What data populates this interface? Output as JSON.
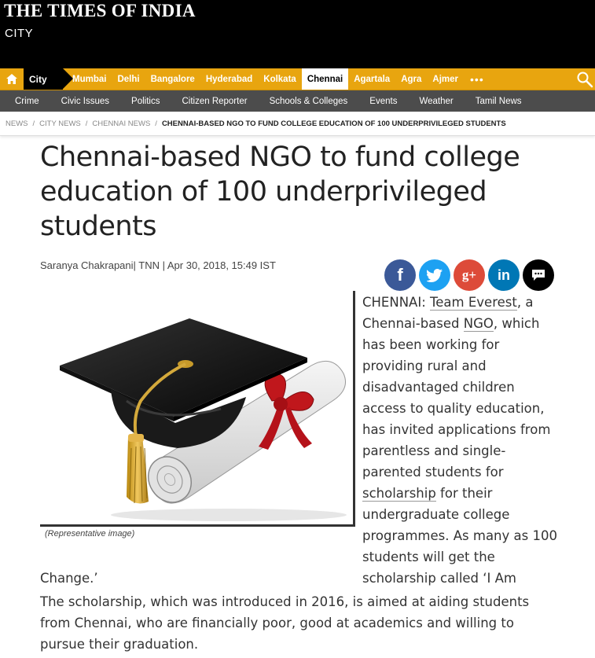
{
  "masthead": {
    "logo": "THE TIMES OF INDIA",
    "section": "CITY"
  },
  "citynav": {
    "current": "City",
    "links": [
      "Mumbai",
      "Delhi",
      "Bangalore",
      "Hyderabad",
      "Kolkata",
      "Chennai",
      "Agartala",
      "Agra",
      "Ajmer"
    ],
    "active": "Chennai",
    "more": "•••"
  },
  "subnav": [
    "Crime",
    "Civic Issues",
    "Politics",
    "Citizen Reporter",
    "Schools & Colleges",
    "Events",
    "Weather",
    "Tamil News"
  ],
  "breadcrumb": {
    "items": [
      "NEWS",
      "CITY NEWS",
      "CHENNAI NEWS"
    ],
    "separator": "/",
    "current": "CHENNAI-BASED NGO TO FUND COLLEGE EDUCATION OF 100 UNDERPRIVILEGED STUDENTS"
  },
  "article": {
    "headline": "Chennai-based NGO to fund college education of 100 underprivileged students",
    "byline": "Saranya Chakrapani| TNN | Apr 30, 2018, 15:49 IST",
    "caption": "(Representative image)",
    "p1": {
      "prefix": "CHENNAI: ",
      "link1": "Team Everest",
      "t1": ", a Chennai-based ",
      "link2": "NGO",
      "t2": ", which has been working for providing rural and disadvantaged children access to quality education, has invited applications from parentless and single-parented students for ",
      "link3": "scholarship",
      "t3": " for their undergraduate college programmes. As many as 100 students will get the scholarship called ‘I Am",
      "cont": "Change.’"
    },
    "p2": "The scholarship, which was introduced in 2016, is aimed at aiding students from Chennai, who are financially poor, good at academics and willing to pursue their graduation."
  },
  "share": {
    "facebook": "f",
    "googleplus": "g+",
    "linkedin": "in"
  },
  "colors": {
    "nav_yellow": "#e8a50f",
    "subnav_grey": "#4c4c4c",
    "facebook": "#3b5998",
    "twitter": "#1da1f2",
    "googleplus": "#dd4b39",
    "linkedin": "#0077b5"
  }
}
